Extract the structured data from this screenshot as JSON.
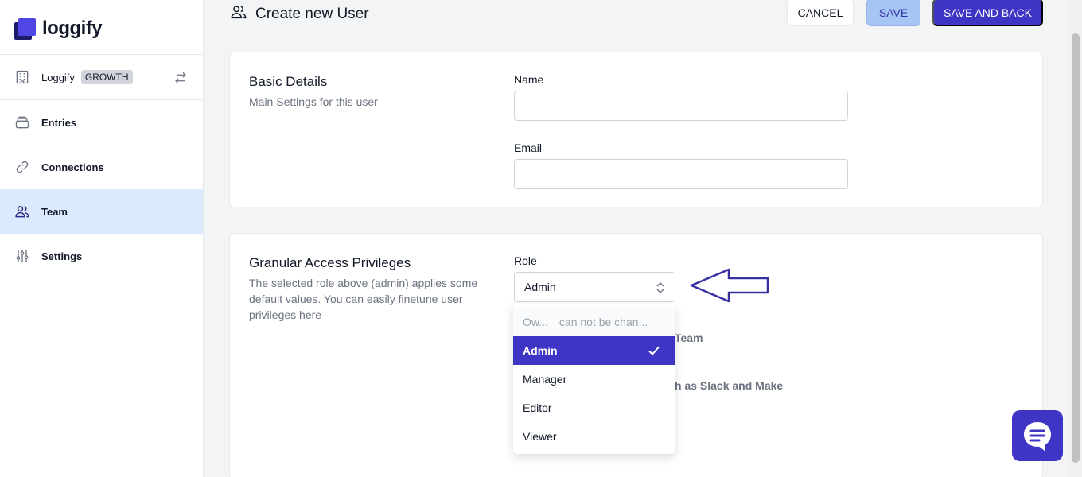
{
  "app": {
    "name": "loggify"
  },
  "sidebar": {
    "workspace": {
      "label": "Loggify",
      "plan": "GROWTH"
    },
    "items": [
      {
        "label": "Entries",
        "icon": "tray-icon"
      },
      {
        "label": "Connections",
        "icon": "link-icon"
      },
      {
        "label": "Team",
        "icon": "users-icon",
        "active": true
      },
      {
        "label": "Settings",
        "icon": "sliders-icon"
      }
    ]
  },
  "header": {
    "title": "Create new User",
    "cancel_label": "CANCEL",
    "save_label": "SAVE",
    "save_back_label": "SAVE AND BACK"
  },
  "basic_details": {
    "title": "Basic Details",
    "description": "Main Settings for this user",
    "name_label": "Name",
    "name_value": "",
    "email_label": "Email",
    "email_value": ""
  },
  "privileges": {
    "title": "Granular Access Privileges",
    "description": "The selected role above (admin) applies some default values. You can easily finetune user privileges here",
    "role_label": "Role",
    "role_value": "Admin",
    "partially_hidden_1": "Team",
    "partially_hidden_2": "h as Slack and Make"
  },
  "role_dropdown": {
    "disabled_option": {
      "label": "Ow...",
      "hint": "can not be chan..."
    },
    "options": [
      "Admin",
      "Manager",
      "Editor",
      "Viewer"
    ],
    "selected": "Admin"
  },
  "colors": {
    "primary": "#3f35c5",
    "active_nav": "#dbeafe",
    "annotation_arrow": "#3730a3"
  }
}
